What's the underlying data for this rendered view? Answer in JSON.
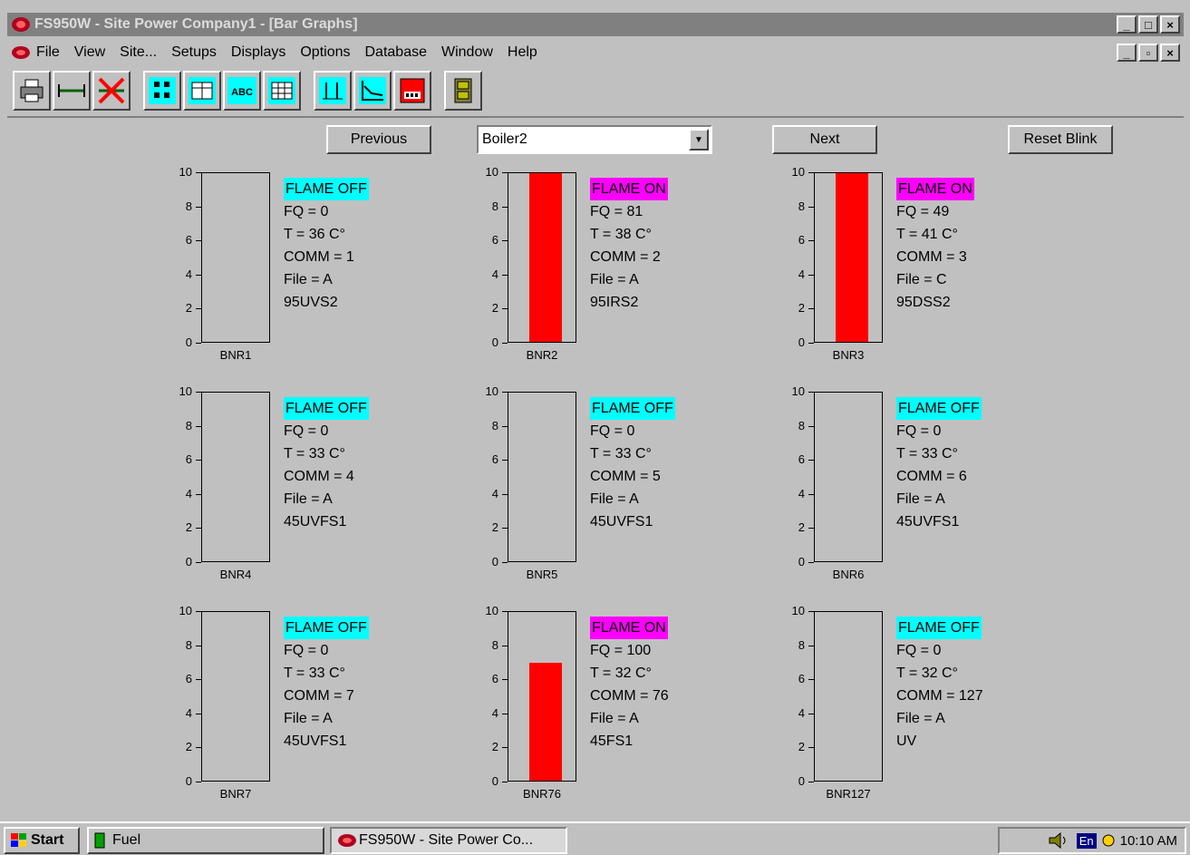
{
  "window": {
    "title": "FS950W - Site Power Company1 - [Bar Graphs]",
    "controls": [
      "_",
      "□",
      "×"
    ],
    "child_controls": [
      "_",
      "▫",
      "×"
    ]
  },
  "menu": [
    "File",
    "View",
    "Site...",
    "Setups",
    "Displays",
    "Options",
    "Database",
    "Window",
    "Help"
  ],
  "toolbar": {
    "icons": [
      "printer-icon",
      "connect-icon",
      "disconnect-icon",
      "two-column-icon",
      "grid-view-icon",
      "abc-icon",
      "table-icon",
      "bar-graph-icon",
      "trend-graph-icon",
      "calculator-icon",
      "file-cabinet-icon"
    ],
    "abc_label": "ABC"
  },
  "nav": {
    "previous": "Previous",
    "next": "Next",
    "reset": "Reset Blink",
    "selected": "Boiler2"
  },
  "axis_ticks": [
    "10",
    "8",
    "6",
    "4",
    "2",
    "0"
  ],
  "colors": {
    "flame_off": "#00ffff",
    "flame_on": "#ff00ff",
    "bar": "#ff0000"
  },
  "burners": [
    {
      "name": "BNR1",
      "status": "FLAME OFF",
      "on": false,
      "fq": "FQ = 0",
      "t": "T = 36 C°",
      "comm": "COMM = 1",
      "file": "File = A",
      "model": "95UVS2",
      "level": 0
    },
    {
      "name": "BNR2",
      "status": "FLAME ON",
      "on": true,
      "fq": "FQ = 81",
      "t": "T = 38 C°",
      "comm": "COMM = 2",
      "file": "File = A",
      "model": "95IRS2",
      "level": 10
    },
    {
      "name": "BNR3",
      "status": "FLAME ON",
      "on": true,
      "fq": "FQ = 49",
      "t": "T = 41 C°",
      "comm": "COMM = 3",
      "file": "File = C",
      "model": "95DSS2",
      "level": 10
    },
    {
      "name": "BNR4",
      "status": "FLAME OFF",
      "on": false,
      "fq": "FQ = 0",
      "t": "T = 33 C°",
      "comm": "COMM = 4",
      "file": "File = A",
      "model": "45UVFS1",
      "level": 0
    },
    {
      "name": "BNR5",
      "status": "FLAME OFF",
      "on": false,
      "fq": "FQ = 0",
      "t": "T = 33 C°",
      "comm": "COMM = 5",
      "file": "File = A",
      "model": "45UVFS1",
      "level": 0
    },
    {
      "name": "BNR6",
      "status": "FLAME OFF",
      "on": false,
      "fq": "FQ = 0",
      "t": "T = 33 C°",
      "comm": "COMM = 6",
      "file": "File = A",
      "model": "45UVFS1",
      "level": 0
    },
    {
      "name": "BNR7",
      "status": "FLAME OFF",
      "on": false,
      "fq": "FQ = 0",
      "t": "T = 33 C°",
      "comm": "COMM = 7",
      "file": "File = A",
      "model": "45UVFS1",
      "level": 0
    },
    {
      "name": "BNR76",
      "status": "FLAME ON",
      "on": true,
      "fq": "FQ = 100",
      "t": "T = 32 C°",
      "comm": "COMM = 76",
      "file": "File = A",
      "model": "45FS1",
      "level": 7
    },
    {
      "name": "BNR127",
      "status": "FLAME OFF",
      "on": false,
      "fq": "FQ = 0",
      "t": "T = 32 C°",
      "comm": "COMM = 127",
      "file": "File = A",
      "model": "UV",
      "level": 0
    }
  ],
  "taskbar": {
    "start": "Start",
    "tasks": [
      "Fuel",
      "FS950W - Site Power Co..."
    ],
    "tray_lang": "En",
    "clock": "10:10 AM"
  }
}
